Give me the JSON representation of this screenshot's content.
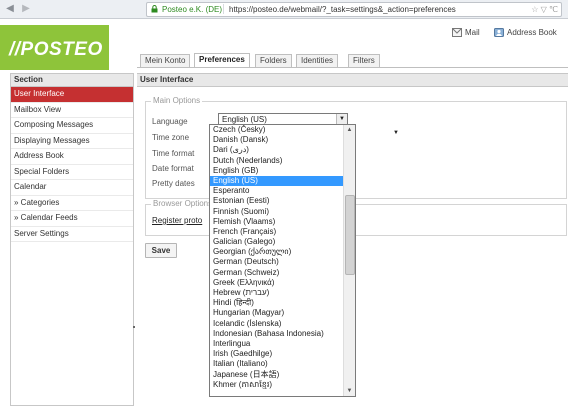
{
  "browser": {
    "identity": "Posteo e.K. (DE)",
    "url": "https://posteo.de/webmail/?_task=settings&_action=preferences",
    "url_icons": "☆ ▽ ℃"
  },
  "header": {
    "logo": "//POSTEO",
    "mail_label": "Mail",
    "address_book_label": "Address Book"
  },
  "tabs": [
    {
      "label": "Mein Konto"
    },
    {
      "label": "Preferences"
    },
    {
      "label": "Folders"
    },
    {
      "label": "Identities"
    },
    {
      "label": "Filters"
    }
  ],
  "sidebar": {
    "title": "Section",
    "items": [
      {
        "label": "User Interface"
      },
      {
        "label": "Mailbox View"
      },
      {
        "label": "Composing Messages"
      },
      {
        "label": "Displaying Messages"
      },
      {
        "label": "Address Book"
      },
      {
        "label": "Special Folders"
      },
      {
        "label": "Calendar"
      },
      {
        "label": "» Categories"
      },
      {
        "label": "» Calendar Feeds"
      },
      {
        "label": "Server Settings"
      }
    ]
  },
  "main": {
    "title": "User Interface",
    "main_options_legend": "Main Options",
    "labels": {
      "language": "Language",
      "time_zone": "Time zone",
      "time_format": "Time format",
      "date_format": "Date format",
      "pretty_dates": "Pretty dates"
    },
    "language_value": "English (US)",
    "browser_options_legend": "Browser Options",
    "register_link": "Register proto",
    "save_label": "Save"
  },
  "language_options": [
    "Czech (Česky)",
    "Danish (Dansk)",
    "Dari (دری)",
    "Dutch (Nederlands)",
    "English (GB)",
    "English (US)",
    "Esperanto",
    "Estonian (Eesti)",
    "Finnish (Suomi)",
    "Flemish (Vlaams)",
    "French (Français)",
    "Galician (Galego)",
    "Georgian (ქართული)",
    "German (Deutsch)",
    "German (Schweiz)",
    "Greek (Ελληνικά)",
    "Hebrew (עברית)",
    "Hindi (हिन्दी)",
    "Hungarian (Magyar)",
    "Icelandic (Íslenska)",
    "Indonesian (Bahasa Indonesia)",
    "Interlingua",
    "Irish (Gaedhilge)",
    "Italian (Italiano)",
    "Japanese (日本語)",
    "Khmer (ភាសាខ្មែរ)"
  ],
  "selected_language_index": 5,
  "colors": {
    "brand_green": "#8ec43a",
    "selection_red": "#c53031",
    "highlight_blue": "#3399ff"
  }
}
